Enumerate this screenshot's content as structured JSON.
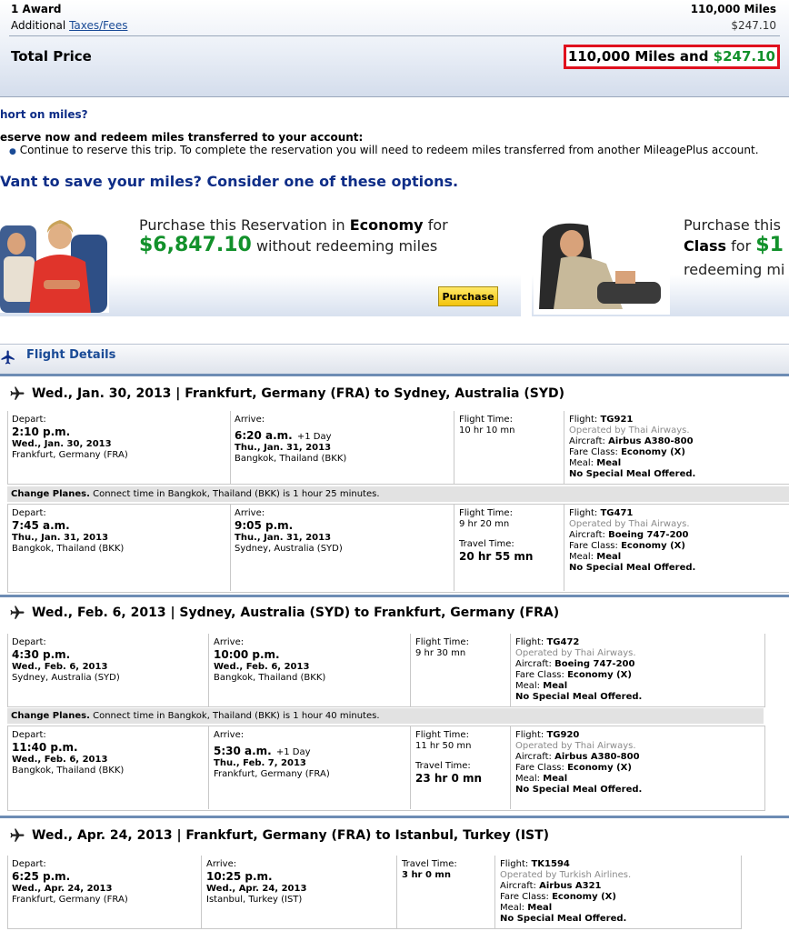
{
  "price": {
    "award_label": "1 Award",
    "award_value": "110,000 Miles",
    "taxes_prefix": "Additional",
    "taxes_link": "Taxes/Fees",
    "taxes_value": "$247.10",
    "total_label": "Total Price",
    "total_miles": "110,000 Miles and",
    "total_cash": "$247.10"
  },
  "short": {
    "link": "hort on miles?",
    "reserve_heading": "eserve now and redeem miles transferred to your account:",
    "reserve_bullet": "Continue to reserve this trip. To complete the reservation you will need to redeem miles transferred from another MileagePlus account.",
    "save_heading": "Vant to save your miles? Consider one of these options."
  },
  "promo_left": {
    "line1_pre": "Purchase this Reservation in",
    "line1_class": "Economy",
    "line1_post": "for",
    "price": "$6,847.10",
    "price_post": "without redeeming miles",
    "button": "Purchase"
  },
  "promo_right": {
    "line1": "Purchase this",
    "line2_class": "Class",
    "line2_for": "for",
    "line2_price": "$1",
    "line3": "redeeming mi"
  },
  "flight_details": {
    "title": "Flight Details"
  },
  "legs": [
    {
      "title": "Wed., Jan. 30, 2013 | Frankfurt, Germany (FRA) to Sydney, Australia (SYD)",
      "segments": [
        {
          "depart_label": "Depart:",
          "depart_time": "2:10 p.m.",
          "depart_date": "Wed., Jan. 30, 2013",
          "depart_city": "Frankfurt, Germany (FRA)",
          "arrive_label": "Arrive:",
          "arrive_time": "6:20 a.m.",
          "arrive_extra": "+1 Day",
          "arrive_date": "Thu., Jan. 31, 2013",
          "arrive_city": "Bangkok, Thailand (BKK)",
          "time_label": "Flight Time:",
          "time_value": "10 hr 10 mn",
          "flight_label": "Flight:",
          "flight_no": "TG921",
          "operated": "Operated by Thai Airways.",
          "aircraft_label": "Aircraft:",
          "aircraft": "Airbus A380-800",
          "fare_label": "Fare Class:",
          "fare": "Economy (X)",
          "meal_label": "Meal:",
          "meal": "Meal",
          "special": "No Special Meal Offered."
        },
        {
          "depart_label": "Depart:",
          "depart_time": "7:45 a.m.",
          "depart_date": "Thu., Jan. 31, 2013",
          "depart_city": "Bangkok, Thailand (BKK)",
          "arrive_label": "Arrive:",
          "arrive_time": "9:05 p.m.",
          "arrive_extra": "",
          "arrive_date": "Thu., Jan. 31, 2013",
          "arrive_city": "Sydney, Australia (SYD)",
          "time_label": "Flight Time:",
          "time_value": "9 hr 20 mn",
          "travel_label": "Travel Time:",
          "travel_value": "20 hr 55 mn",
          "flight_label": "Flight:",
          "flight_no": "TG471",
          "operated": "Operated by Thai Airways.",
          "aircraft_label": "Aircraft:",
          "aircraft": "Boeing 747-200",
          "fare_label": "Fare Class:",
          "fare": "Economy (X)",
          "meal_label": "Meal:",
          "meal": "Meal",
          "special": "No Special Meal Offered."
        }
      ],
      "change_bold": "Change Planes.",
      "change_text": "Connect time in Bangkok, Thailand (BKK) is 1 hour 25 minutes."
    },
    {
      "title": "Wed., Feb. 6, 2013 | Sydney, Australia (SYD) to Frankfurt, Germany (FRA)",
      "segments": [
        {
          "depart_label": "Depart:",
          "depart_time": "4:30 p.m.",
          "depart_date": "Wed., Feb. 6, 2013",
          "depart_city": "Sydney, Australia (SYD)",
          "arrive_label": "Arrive:",
          "arrive_time": "10:00 p.m.",
          "arrive_extra": "",
          "arrive_date": "Wed., Feb. 6, 2013",
          "arrive_city": "Bangkok, Thailand (BKK)",
          "time_label": "Flight Time:",
          "time_value": "9 hr 30 mn",
          "flight_label": "Flight:",
          "flight_no": "TG472",
          "operated": "Operated by Thai Airways.",
          "aircraft_label": "Aircraft:",
          "aircraft": "Boeing 747-200",
          "fare_label": "Fare Class:",
          "fare": "Economy (X)",
          "meal_label": "Meal:",
          "meal": "Meal",
          "special": "No Special Meal Offered."
        },
        {
          "depart_label": "Depart:",
          "depart_time": "11:40 p.m.",
          "depart_date": "Wed., Feb. 6, 2013",
          "depart_city": "Bangkok, Thailand (BKK)",
          "arrive_label": "Arrive:",
          "arrive_time": "5:30 a.m.",
          "arrive_extra": "+1 Day",
          "arrive_date": "Thu., Feb. 7, 2013",
          "arrive_city": "Frankfurt, Germany (FRA)",
          "time_label": "Flight Time:",
          "time_value": "11 hr 50 mn",
          "travel_label": "Travel Time:",
          "travel_value": "23 hr 0 mn",
          "flight_label": "Flight:",
          "flight_no": "TG920",
          "operated": "Operated by Thai Airways.",
          "aircraft_label": "Aircraft:",
          "aircraft": "Airbus A380-800",
          "fare_label": "Fare Class:",
          "fare": "Economy (X)",
          "meal_label": "Meal:",
          "meal": "Meal",
          "special": "No Special Meal Offered."
        }
      ],
      "change_bold": "Change Planes.",
      "change_text": "Connect time in Bangkok, Thailand (BKK) is 1 hour 40 minutes."
    },
    {
      "title": "Wed., Apr. 24, 2013 | Frankfurt, Germany (FRA) to Istanbul, Turkey (IST)",
      "segments": [
        {
          "depart_label": "Depart:",
          "depart_time": "6:25 p.m.",
          "depart_date": "Wed., Apr. 24, 2013",
          "depart_city": "Frankfurt, Germany (FRA)",
          "arrive_label": "Arrive:",
          "arrive_time": "10:25 p.m.",
          "arrive_extra": "",
          "arrive_date": "Wed., Apr. 24, 2013",
          "arrive_city": "Istanbul, Turkey (IST)",
          "time_label": "Travel Time:",
          "time_value": "3 hr 0 mn",
          "flight_label": "Flight:",
          "flight_no": "TK1594",
          "operated": "Operated by Turkish Airlines.",
          "aircraft_label": "Aircraft:",
          "aircraft": "Airbus A321",
          "fare_label": "Fare Class:",
          "fare": "Economy (X)",
          "meal_label": "Meal:",
          "meal": "Meal",
          "special": "No Special Meal Offered."
        }
      ]
    }
  ]
}
